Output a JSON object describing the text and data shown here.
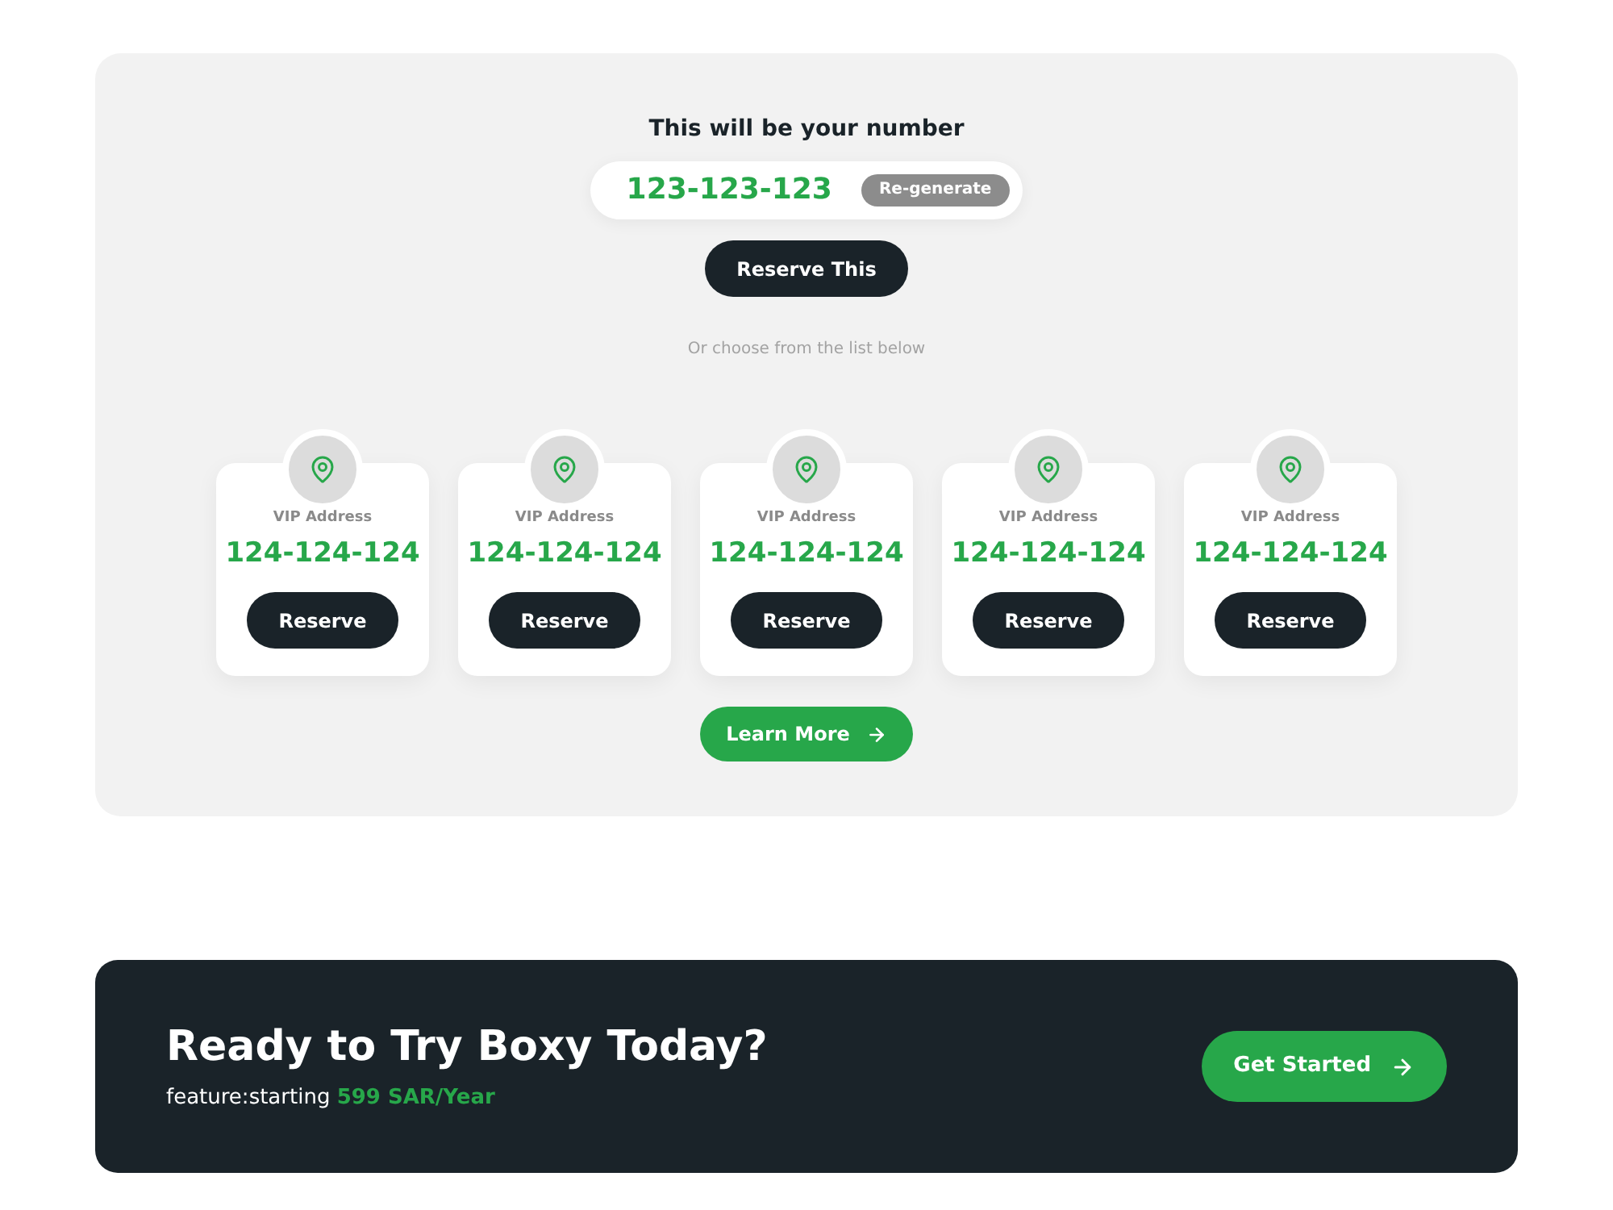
{
  "hero": {
    "title": "This will be your number",
    "number": "123-123-123",
    "regenerate_button": "Re-generate",
    "reserve_button": "Reserve This",
    "hint": "Or choose from the list below"
  },
  "cards": [
    {
      "label": "VIP Address",
      "number": "124-124-124",
      "button": "Reserve"
    },
    {
      "label": "VIP Address",
      "number": "124-124-124",
      "button": "Reserve"
    },
    {
      "label": "VIP Address",
      "number": "124-124-124",
      "button": "Reserve"
    },
    {
      "label": "VIP Address",
      "number": "124-124-124",
      "button": "Reserve"
    },
    {
      "label": "VIP Address",
      "number": "124-124-124",
      "button": "Reserve"
    }
  ],
  "learn_more_button": "Learn More",
  "cta": {
    "title": "Ready to Try Boxy Today?",
    "subtitle": "feature:starting **599 SAR/Year**",
    "button": "Get Started"
  }
}
